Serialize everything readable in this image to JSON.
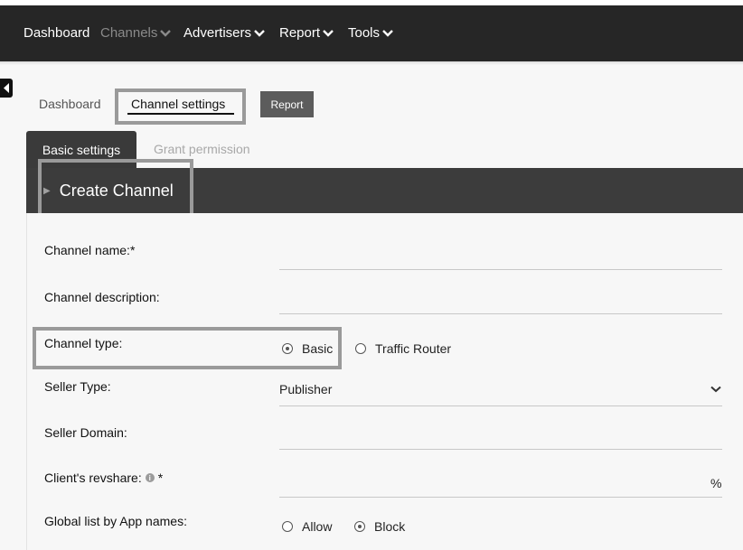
{
  "topnav": {
    "items": [
      {
        "label": "Dashboard",
        "has_dropdown": false,
        "disabled": false
      },
      {
        "label": "Channels",
        "has_dropdown": true,
        "disabled": true
      },
      {
        "label": "Advertisers",
        "has_dropdown": true,
        "disabled": false
      },
      {
        "label": "Report",
        "has_dropdown": true,
        "disabled": false
      },
      {
        "label": "Tools",
        "has_dropdown": true,
        "disabled": false
      }
    ]
  },
  "subnav": {
    "dashboard": "Dashboard",
    "channel_settings": "Channel settings",
    "report_button": "Report"
  },
  "tabs": {
    "basic": "Basic settings",
    "grant": "Grant permission"
  },
  "panel": {
    "title": "Create Channel"
  },
  "form": {
    "channel_name": {
      "label": "Channel name:",
      "required": "*",
      "value": ""
    },
    "channel_description": {
      "label": "Channel description:",
      "value": ""
    },
    "channel_type": {
      "label": "Channel type:",
      "options": [
        "Basic",
        "Traffic Router"
      ],
      "selected": "Basic"
    },
    "seller_type": {
      "label": "Seller Type:",
      "value": "Publisher"
    },
    "seller_domain": {
      "label": "Seller Domain:",
      "value": ""
    },
    "client_revshare": {
      "label": "Client's revshare:",
      "required": "*",
      "suffix": "%",
      "value": ""
    },
    "global_list": {
      "label": "Global list by App names:",
      "options": [
        "Allow",
        "Block"
      ],
      "selected": "Block"
    }
  },
  "colors": {
    "nav_bg": "#262626",
    "panel_header_bg": "#3c3c3c",
    "highlight_box": "#9a9a9a",
    "report_button_bg": "#5c5c5c"
  }
}
